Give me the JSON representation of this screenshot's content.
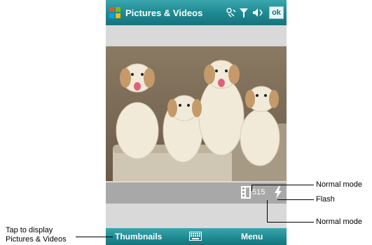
{
  "titlebar": {
    "title": "Pictures & Videos",
    "icons": [
      "windows-start-icon",
      "connectivity-icon",
      "signal-icon",
      "volume-icon"
    ],
    "ok_label": "ok"
  },
  "viewer": {
    "photo_description_icon": "puppies-photo",
    "mode_icon": "film-strip-icon",
    "counter": "515",
    "flash_icon": "flash-icon"
  },
  "softbar": {
    "left_label": "Thumbnails",
    "center_icon": "keyboard-icon",
    "right_label": "Menu"
  },
  "callouts": {
    "normal_mode_top": "Normal mode",
    "flash": "Flash",
    "normal_mode_bottom": "Normal mode",
    "tap_line1": "Tap to display",
    "tap_line2": "Pictures & Videos"
  },
  "colors": {
    "titlebar": "#1f8a93",
    "content_bg": "#d9d9d9",
    "status_strip": "#a8a8a8"
  }
}
